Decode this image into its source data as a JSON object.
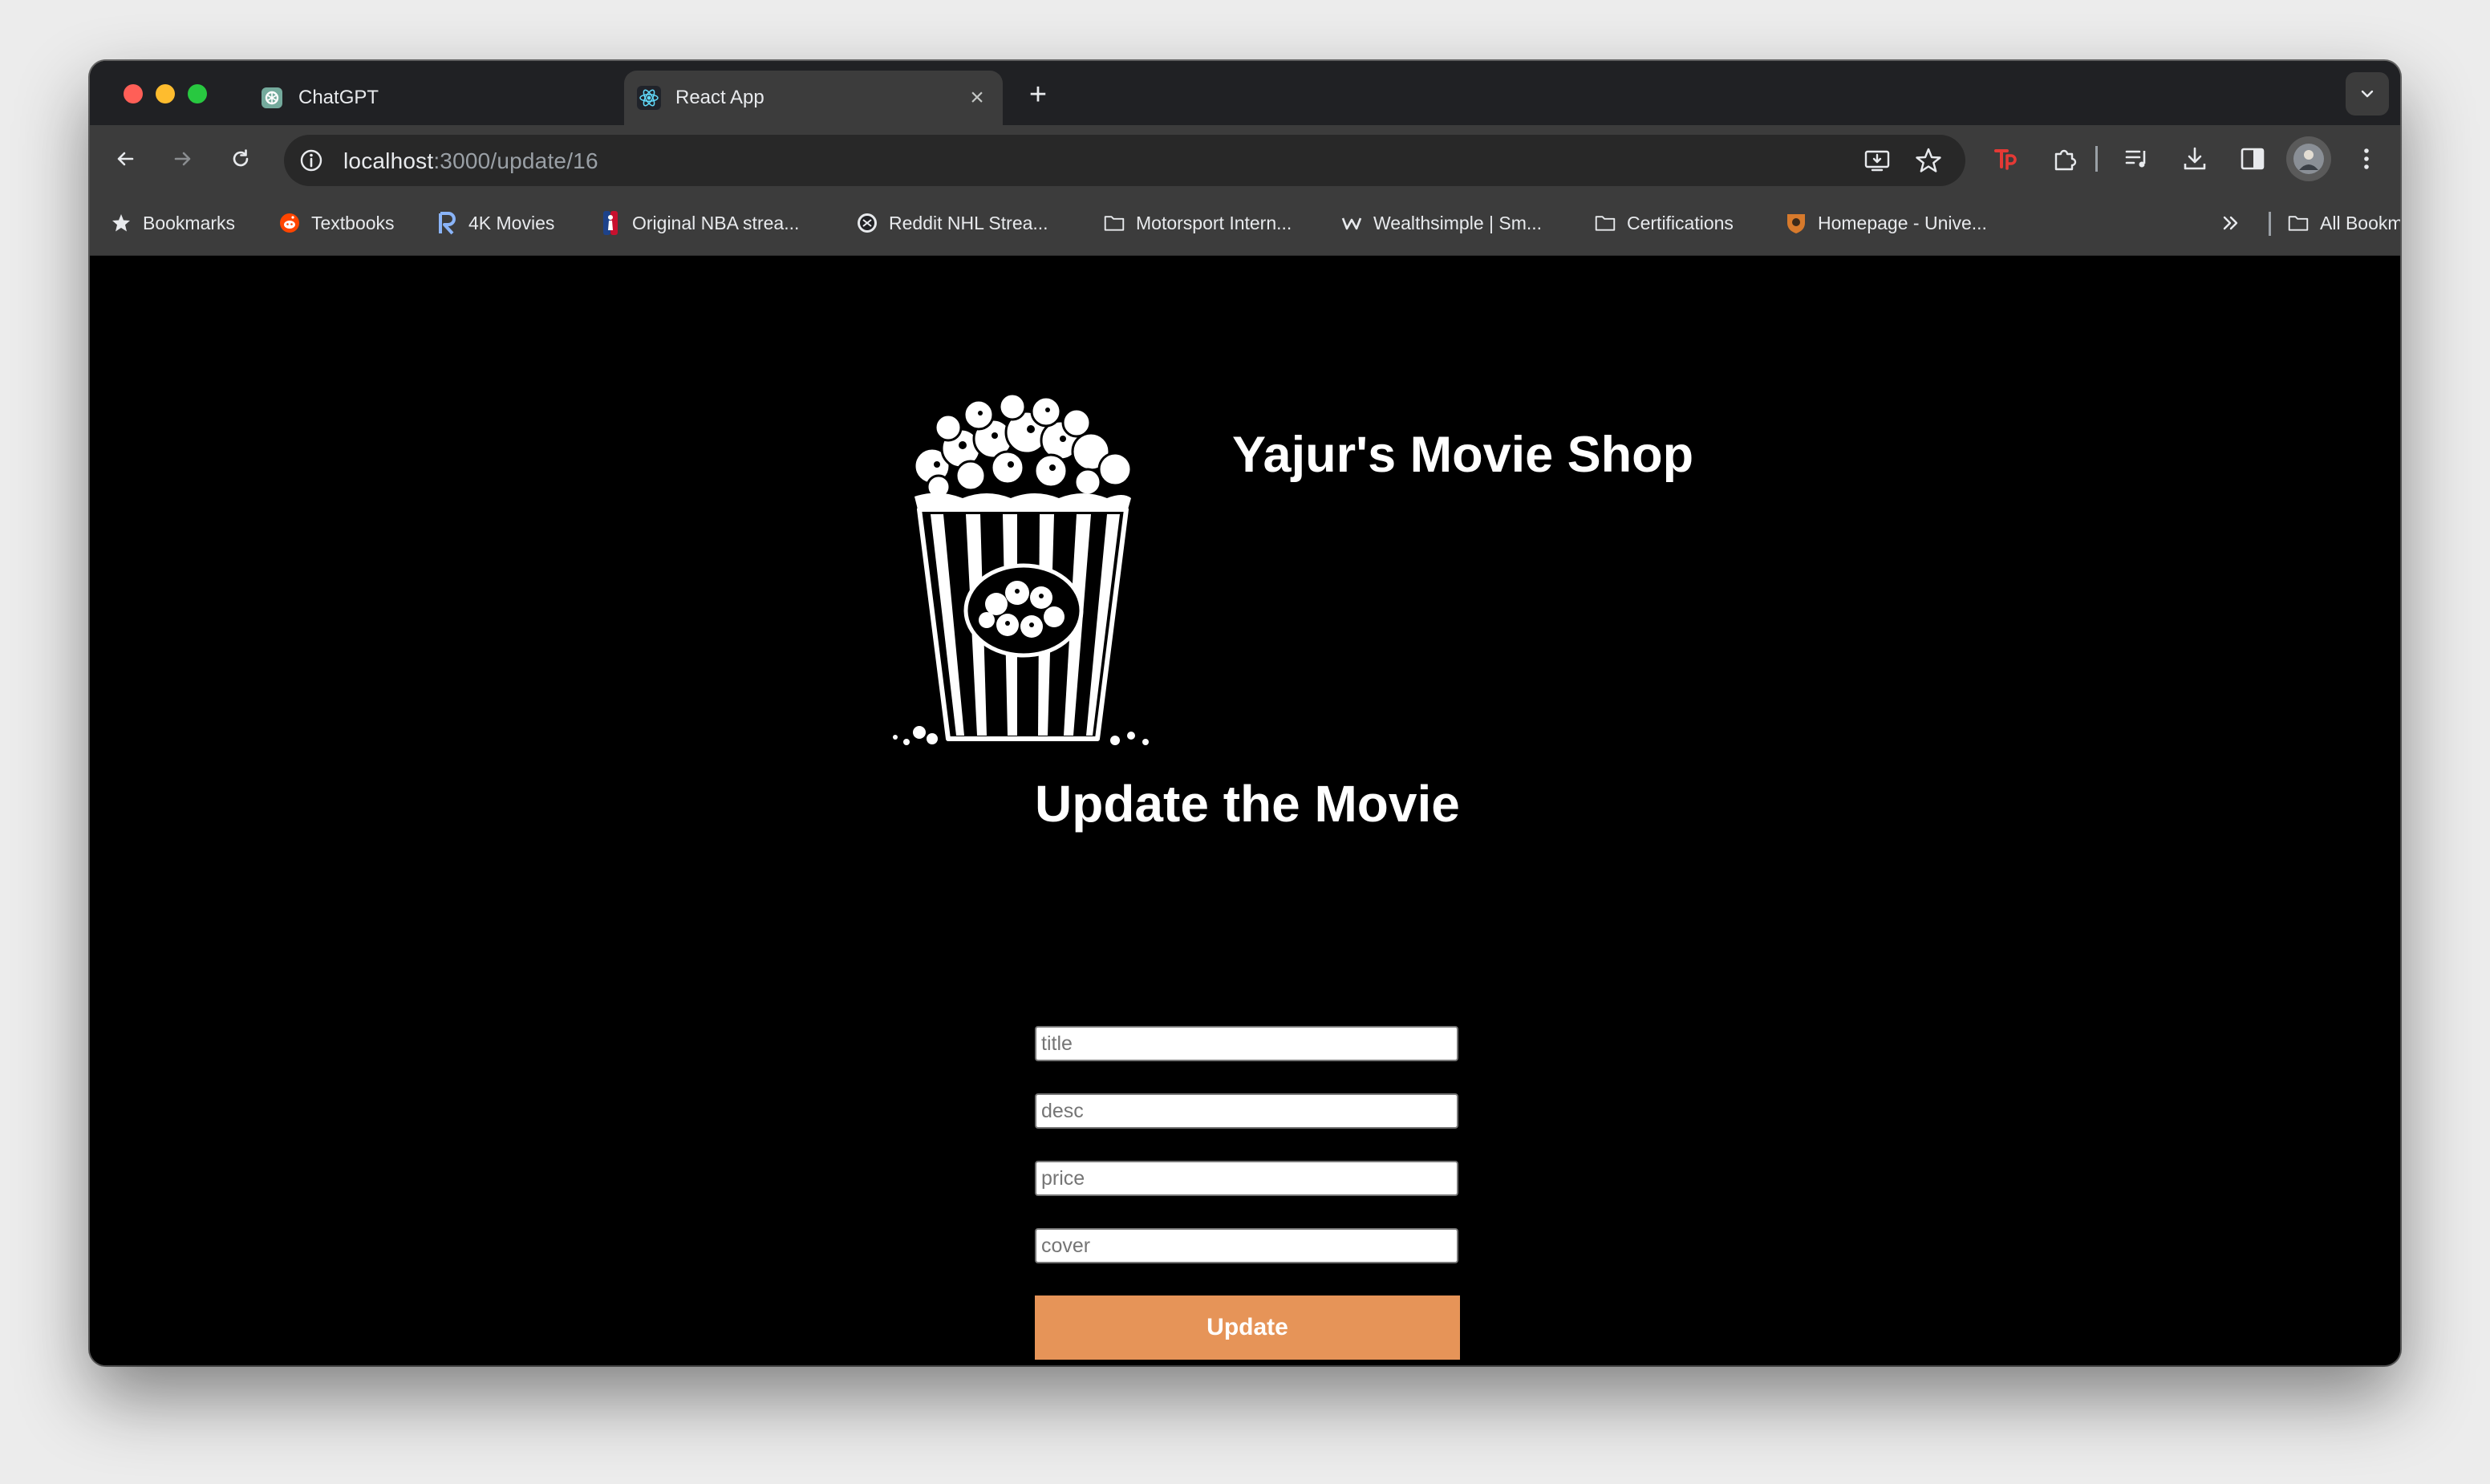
{
  "browser": {
    "tabs": [
      {
        "title": "ChatGPT",
        "icon": "chatgpt-icon",
        "active": false
      },
      {
        "title": "React App",
        "icon": "react-icon",
        "active": true
      }
    ],
    "url": {
      "host": "localhost",
      "path": ":3000/update/16"
    },
    "bookmarks": [
      {
        "label": "Bookmarks",
        "icon": "star-icon"
      },
      {
        "label": "Textbooks",
        "icon": "reddit-icon"
      },
      {
        "label": "4K Movies",
        "icon": "r-logo-icon"
      },
      {
        "label": "Original NBA strea...",
        "icon": "nba-icon"
      },
      {
        "label": "Reddit NHL Strea...",
        "icon": "nhl-icon"
      },
      {
        "label": "Motorsport Intern...",
        "icon": "folder-icon"
      },
      {
        "label": "Wealthsimple | Sm...",
        "icon": "wealthsimple-icon"
      },
      {
        "label": "Certifications",
        "icon": "folder-icon"
      },
      {
        "label": "Homepage - Unive...",
        "icon": "university-crest-icon"
      }
    ],
    "all_bookmarks": "All Bookmarks"
  },
  "page": {
    "shop_title": "Yajur's Movie Shop",
    "logo": "popcorn-icon",
    "form_heading": "Update the Movie",
    "fields": {
      "title": {
        "placeholder": "title",
        "value": ""
      },
      "desc": {
        "placeholder": "desc",
        "value": ""
      },
      "price": {
        "placeholder": "price",
        "value": ""
      },
      "cover": {
        "placeholder": "cover",
        "value": ""
      }
    },
    "submit_label": "Update"
  },
  "colors": {
    "page_background": "#000000",
    "button": "#e69458",
    "tab_strip": "#202124",
    "toolbar": "#3c3c3c"
  }
}
